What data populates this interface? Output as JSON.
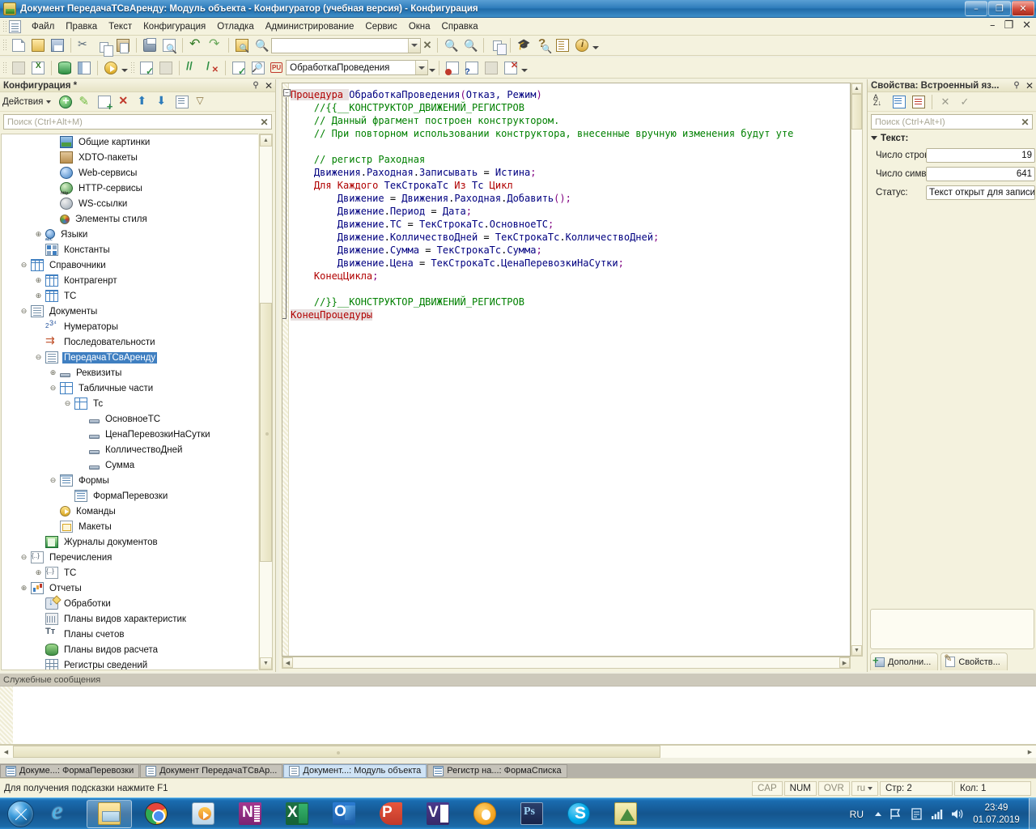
{
  "window": {
    "title": "Документ ПередачаТСвАренду: Модуль объекта - Конфигуратор (учебная версия) - Конфигурация",
    "minimize": "–",
    "maximize": "❐",
    "close": "✕",
    "mdi_minimize": "–",
    "mdi_restore": "❐",
    "mdi_close": "✕"
  },
  "menu": {
    "items": [
      {
        "label": "Файл"
      },
      {
        "label": "Правка"
      },
      {
        "label": "Текст"
      },
      {
        "label": "Конфигурация"
      },
      {
        "label": "Отладка"
      },
      {
        "label": "Администрирование"
      },
      {
        "label": "Сервис"
      },
      {
        "label": "Окна"
      },
      {
        "label": "Справка"
      }
    ]
  },
  "toolbar1": {
    "buttons": [
      {
        "name": "new-icon",
        "cls": "page"
      },
      {
        "name": "open-icon",
        "cls": "folder"
      },
      {
        "name": "save-icon",
        "cls": "save"
      },
      {
        "name": "cut-icon",
        "cls": "scissors"
      },
      {
        "name": "copy-icon",
        "cls": "copy"
      },
      {
        "name": "paste-icon",
        "cls": "paste"
      },
      {
        "name": "print-icon",
        "cls": "print"
      },
      {
        "name": "print-preview-icon",
        "cls": "preview"
      },
      {
        "name": "undo-icon",
        "cls": "undo"
      },
      {
        "name": "redo-icon",
        "cls": "redo"
      },
      {
        "name": "find-in-files-icon",
        "cls": "findfile"
      },
      {
        "name": "search-icon",
        "cls": "mag"
      }
    ],
    "search_value": "",
    "clear_label": "✕",
    "right_buttons": [
      {
        "name": "find-next-icon",
        "cls": "mag"
      },
      {
        "name": "find-prev-icon",
        "cls": "mag"
      },
      {
        "name": "compare-icon",
        "cls": "dup"
      },
      {
        "name": "user-icon",
        "cls": "grad"
      },
      {
        "name": "syntax-help-icon",
        "cls": "help"
      },
      {
        "name": "manual-icon",
        "cls": "book"
      },
      {
        "name": "about-icon",
        "cls": "info"
      }
    ]
  },
  "toolbar2": {
    "left_buttons": [
      {
        "name": "report-icon",
        "cls": "grey"
      },
      {
        "name": "export-xls-icon",
        "cls": "xls"
      },
      {
        "name": "database-icon",
        "cls": "db"
      },
      {
        "name": "window-icon",
        "cls": "win"
      },
      {
        "name": "start-debug-icon",
        "cls": "play"
      }
    ],
    "mid_buttons": [
      {
        "name": "procedure-list-icon",
        "cls": "chk"
      },
      {
        "name": "next-bookmark-icon",
        "cls": "grey"
      },
      {
        "name": "comment-icon",
        "cls": "slash"
      },
      {
        "name": "uncomment-icon",
        "cls": "slashx"
      },
      {
        "name": "syntax-check-icon",
        "cls": "chk"
      },
      {
        "name": "procedure-search-icon",
        "cls": "proc"
      }
    ],
    "module_combo_value": "ОбработкаПроведения",
    "module_badge": "PU",
    "right_buttons": [
      {
        "name": "set-breakpoint-icon",
        "cls": "bp"
      },
      {
        "name": "conditional-breakpoint-icon",
        "cls": "bpq"
      },
      {
        "name": "breakpoint-list-icon",
        "cls": "grey"
      },
      {
        "name": "remove-breakpoints-icon",
        "cls": "bpx"
      }
    ]
  },
  "config_panel": {
    "title": "Конфигурация *",
    "pin": "⚲",
    "close": "✕",
    "actions_label": "Действия",
    "action_buttons": [
      {
        "name": "add-icon",
        "cls": "plusg"
      },
      {
        "name": "edit-icon",
        "cls": "pencil"
      },
      {
        "name": "copy-object-icon",
        "cls": "pagep"
      },
      {
        "name": "delete-icon",
        "cls": "xred"
      },
      {
        "name": "move-up-icon",
        "cls": "arrup"
      },
      {
        "name": "move-down-icon",
        "cls": "arrdn"
      },
      {
        "name": "sort-icon",
        "cls": "list"
      },
      {
        "name": "filter-icon",
        "cls": "filter"
      }
    ],
    "search_placeholder": "Поиск (Ctrl+Alt+M)",
    "search_value": "",
    "search_clear": "✕",
    "tree": [
      {
        "label": "Общие картинки",
        "indent": 3,
        "exp": "",
        "icon": "img",
        "sel": false
      },
      {
        "label": "XDTO-пакеты",
        "indent": 3,
        "exp": "",
        "icon": "xdto",
        "sel": false
      },
      {
        "label": "Web-сервисы",
        "indent": 3,
        "exp": "",
        "icon": "globe",
        "sel": false
      },
      {
        "label": "HTTP-сервисы",
        "indent": 3,
        "exp": "",
        "icon": "globe2",
        "sel": false
      },
      {
        "label": "WS-ссылки",
        "indent": 3,
        "exp": "",
        "icon": "globe3",
        "sel": false
      },
      {
        "label": "Элементы стиля",
        "indent": 3,
        "exp": "",
        "icon": "style",
        "sel": false
      },
      {
        "label": "Языки",
        "indent": 2,
        "exp": "⊕",
        "icon": "lang",
        "sel": false
      },
      {
        "label": "Константы",
        "indent": 2,
        "exp": "",
        "icon": "const",
        "sel": false
      },
      {
        "label": "Справочники",
        "indent": 1,
        "exp": "⊖",
        "icon": "cat",
        "sel": false
      },
      {
        "label": "Контрагенрт",
        "indent": 2,
        "exp": "⊕",
        "icon": "cat",
        "sel": false
      },
      {
        "label": "ТС",
        "indent": 2,
        "exp": "⊕",
        "icon": "cat",
        "sel": false
      },
      {
        "label": "Документы",
        "indent": 1,
        "exp": "⊖",
        "icon": "doc",
        "sel": false
      },
      {
        "label": "Нумераторы",
        "indent": 2,
        "exp": "",
        "icon": "num",
        "sel": false
      },
      {
        "label": "Последовательности",
        "indent": 2,
        "exp": "",
        "icon": "seq",
        "sel": false
      },
      {
        "label": "ПередачаТСвАренду",
        "indent": 2,
        "exp": "⊖",
        "icon": "doc",
        "sel": true
      },
      {
        "label": "Реквизиты",
        "indent": 3,
        "exp": "⊕",
        "icon": "attr",
        "sel": false
      },
      {
        "label": "Табличные части",
        "indent": 3,
        "exp": "⊖",
        "icon": "tab",
        "sel": false
      },
      {
        "label": "Тс",
        "indent": 4,
        "exp": "⊖",
        "icon": "tab",
        "sel": false
      },
      {
        "label": "ОсновноеТС",
        "indent": 5,
        "exp": "",
        "icon": "attr",
        "sel": false
      },
      {
        "label": "ЦенаПеревозкиНаСутки",
        "indent": 5,
        "exp": "",
        "icon": "attr",
        "sel": false
      },
      {
        "label": "КолличествоДней",
        "indent": 5,
        "exp": "",
        "icon": "attr",
        "sel": false
      },
      {
        "label": "Сумма",
        "indent": 5,
        "exp": "",
        "icon": "attr",
        "sel": false
      },
      {
        "label": "Формы",
        "indent": 3,
        "exp": "⊖",
        "icon": "form",
        "sel": false
      },
      {
        "label": "ФормаПеревозки",
        "indent": 4,
        "exp": "",
        "icon": "form",
        "sel": false
      },
      {
        "label": "Команды",
        "indent": 3,
        "exp": "",
        "icon": "cmd",
        "sel": false
      },
      {
        "label": "Макеты",
        "indent": 3,
        "exp": "",
        "icon": "layout",
        "sel": false
      },
      {
        "label": "Журналы документов",
        "indent": 2,
        "exp": "",
        "icon": "jour",
        "sel": false
      },
      {
        "label": "Перечисления",
        "indent": 1,
        "exp": "⊖",
        "icon": "enum",
        "sel": false
      },
      {
        "label": "ТС",
        "indent": 2,
        "exp": "⊕",
        "icon": "enum",
        "sel": false
      },
      {
        "label": "Отчеты",
        "indent": 1,
        "exp": "⊕",
        "icon": "rep",
        "sel": false
      },
      {
        "label": "Обработки",
        "indent": 2,
        "exp": "",
        "icon": "dp",
        "sel": false
      },
      {
        "label": "Планы видов характеристик",
        "indent": 2,
        "exp": "",
        "icon": "pvh",
        "sel": false
      },
      {
        "label": "Планы счетов",
        "indent": 2,
        "exp": "",
        "icon": "acc",
        "sel": false
      },
      {
        "label": "Планы видов расчета",
        "indent": 2,
        "exp": "",
        "icon": "calc",
        "sel": false
      },
      {
        "label": "Регистры сведений",
        "indent": 2,
        "exp": "",
        "icon": "reg",
        "sel": false
      }
    ]
  },
  "editor": {
    "lines": [
      [
        {
          "t": "Процедура ",
          "c": "kwsel"
        },
        {
          "t": "ОбработкаПроведения",
          "c": "id"
        },
        {
          "t": "(",
          "c": "pn"
        },
        {
          "t": "Отказ, Режим",
          "c": "id"
        },
        {
          "t": ")",
          "c": "pn"
        }
      ],
      [
        {
          "t": "    //{{__КОНСТРУКТОР_ДВИЖЕНИЙ_РЕГИСТРОВ",
          "c": "cm"
        }
      ],
      [
        {
          "t": "    // Данный фрагмент построен конструктором.",
          "c": "cm"
        }
      ],
      [
        {
          "t": "    // При повторном использовании конструктора, внесенные вручную изменения будут уте",
          "c": "cm"
        }
      ],
      [
        {
          "t": "",
          "c": "cm"
        }
      ],
      [
        {
          "t": "    // регистр Раходная",
          "c": "cm"
        }
      ],
      [
        {
          "t": "    Движения",
          "c": "id"
        },
        {
          "t": ".",
          "c": "op"
        },
        {
          "t": "Раходная",
          "c": "id"
        },
        {
          "t": ".",
          "c": "op"
        },
        {
          "t": "Записывать ",
          "c": "id"
        },
        {
          "t": "= ",
          "c": "op"
        },
        {
          "t": "Истина",
          "c": "id"
        },
        {
          "t": ";",
          "c": "pn"
        }
      ],
      [
        {
          "t": "    Для Каждого ",
          "c": "kw"
        },
        {
          "t": "ТекСтрокаТс ",
          "c": "id"
        },
        {
          "t": "Из ",
          "c": "kw"
        },
        {
          "t": "Тс ",
          "c": "id"
        },
        {
          "t": "Цикл",
          "c": "kw"
        }
      ],
      [
        {
          "t": "        Движение ",
          "c": "id"
        },
        {
          "t": "= ",
          "c": "op"
        },
        {
          "t": "Движения",
          "c": "id"
        },
        {
          "t": ".",
          "c": "op"
        },
        {
          "t": "Раходная",
          "c": "id"
        },
        {
          "t": ".",
          "c": "op"
        },
        {
          "t": "Добавить",
          "c": "id"
        },
        {
          "t": "();",
          "c": "pn"
        }
      ],
      [
        {
          "t": "        Движение",
          "c": "id"
        },
        {
          "t": ".",
          "c": "op"
        },
        {
          "t": "Период ",
          "c": "id"
        },
        {
          "t": "= ",
          "c": "op"
        },
        {
          "t": "Дата",
          "c": "id"
        },
        {
          "t": ";",
          "c": "pn"
        }
      ],
      [
        {
          "t": "        Движение",
          "c": "id"
        },
        {
          "t": ".",
          "c": "op"
        },
        {
          "t": "ТС ",
          "c": "id"
        },
        {
          "t": "= ",
          "c": "op"
        },
        {
          "t": "ТекСтрокаТс",
          "c": "id"
        },
        {
          "t": ".",
          "c": "op"
        },
        {
          "t": "ОсновноеТС",
          "c": "id"
        },
        {
          "t": ";",
          "c": "pn"
        }
      ],
      [
        {
          "t": "        Движение",
          "c": "id"
        },
        {
          "t": ".",
          "c": "op"
        },
        {
          "t": "КолличествоДней ",
          "c": "id"
        },
        {
          "t": "= ",
          "c": "op"
        },
        {
          "t": "ТекСтрокаТс",
          "c": "id"
        },
        {
          "t": ".",
          "c": "op"
        },
        {
          "t": "КолличествоДней",
          "c": "id"
        },
        {
          "t": ";",
          "c": "pn"
        }
      ],
      [
        {
          "t": "        Движение",
          "c": "id"
        },
        {
          "t": ".",
          "c": "op"
        },
        {
          "t": "Сумма ",
          "c": "id"
        },
        {
          "t": "= ",
          "c": "op"
        },
        {
          "t": "ТекСтрокаТс",
          "c": "id"
        },
        {
          "t": ".",
          "c": "op"
        },
        {
          "t": "Сумма",
          "c": "id"
        },
        {
          "t": ";",
          "c": "pn"
        }
      ],
      [
        {
          "t": "        Движение",
          "c": "id"
        },
        {
          "t": ".",
          "c": "op"
        },
        {
          "t": "Цена ",
          "c": "id"
        },
        {
          "t": "= ",
          "c": "op"
        },
        {
          "t": "ТекСтрокаТс",
          "c": "id"
        },
        {
          "t": ".",
          "c": "op"
        },
        {
          "t": "ЦенаПеревозкиНаСутки",
          "c": "id"
        },
        {
          "t": ";",
          "c": "pn"
        }
      ],
      [
        {
          "t": "    КонецЦикла",
          "c": "kw"
        },
        {
          "t": ";",
          "c": "pn"
        }
      ],
      [
        {
          "t": "",
          "c": "cm"
        }
      ],
      [
        {
          "t": "    //}}__КОНСТРУКТОР_ДВИЖЕНИЙ_РЕГИСТРОВ",
          "c": "cm"
        }
      ],
      [
        {
          "t": "КонецПроцедуры",
          "c": "kwsel"
        }
      ]
    ],
    "fold_open": "−",
    "hscroll_left": "◀",
    "hscroll_right": "▶",
    "vscroll_up": "▲",
    "vscroll_down": "▼"
  },
  "properties_panel": {
    "title": "Свойства: Встроенный яз...",
    "pin": "⚲",
    "close": "✕",
    "toolbar_buttons": [
      {
        "name": "sort-alphabetical-icon",
        "cls": "sortaz"
      },
      {
        "name": "group-by-category-icon",
        "cls": "grp"
      },
      {
        "name": "show-filter-icon",
        "cls": "grp2"
      }
    ],
    "cancel": "✕",
    "apply": "✓",
    "search_placeholder": "Поиск (Ctrl+Alt+I)",
    "search_value": "",
    "search_clear": "✕",
    "group_label": "Текст:",
    "rows": [
      {
        "label": "Число строк",
        "value": "19",
        "align": "num"
      },
      {
        "label": "Число симв",
        "value": "641",
        "align": "num"
      },
      {
        "label": "Статус:",
        "value": "Текст открыт для записи",
        "align": "txt"
      }
    ],
    "tabs": [
      {
        "label": "Дополни...",
        "icon": "addbtn",
        "name": "tab-additional"
      },
      {
        "label": "Свойств...",
        "icon": "propbtn",
        "name": "tab-properties"
      }
    ]
  },
  "messages": {
    "title": "Служебные сообщения",
    "body": "",
    "scroll_left": "◀",
    "scroll_right": "▶"
  },
  "window_tabs": [
    {
      "label": "Докуме...: ФормаПеревозки",
      "icon": "form",
      "active": false
    },
    {
      "label": "Документ ПередачаТСвАр...",
      "icon": "doc",
      "active": false
    },
    {
      "label": "Документ...: Модуль объекта",
      "icon": "doc",
      "active": true
    },
    {
      "label": "Регистр на...: ФормаСписка",
      "icon": "form",
      "active": false
    }
  ],
  "statusbar": {
    "hint": "Для получения подсказки нажмите F1",
    "cap": "CAP",
    "num": "NUM",
    "ovr": "OVR",
    "lang": "ru",
    "line": "Стр: 2",
    "col": "Кол: 1"
  },
  "taskbar": {
    "start": "start-orb",
    "items": [
      {
        "name": "internet-explorer",
        "cls": "ie",
        "active": false
      },
      {
        "name": "file-explorer",
        "cls": "explorer",
        "active": true
      },
      {
        "name": "google-chrome",
        "cls": "chrome",
        "active": false
      },
      {
        "name": "windows-media-player",
        "cls": "wmp",
        "active": false
      },
      {
        "name": "onenote",
        "cls": "onenote",
        "active": false
      },
      {
        "name": "excel",
        "cls": "excel",
        "active": false
      },
      {
        "name": "outlook",
        "cls": "outlook",
        "active": false
      },
      {
        "name": "powerpoint",
        "cls": "ppt",
        "active": false
      },
      {
        "name": "visio",
        "cls": "visio",
        "active": false
      },
      {
        "name": "chrome-canary",
        "cls": "chrome2",
        "active": false
      },
      {
        "name": "photoshop",
        "cls": "ps",
        "active": false
      },
      {
        "name": "skype",
        "cls": "skype",
        "active": false
      },
      {
        "name": "compass-app",
        "cls": "cad",
        "active": false
      }
    ],
    "lang": "RU",
    "time": "23:49",
    "date": "01.07.2019"
  }
}
